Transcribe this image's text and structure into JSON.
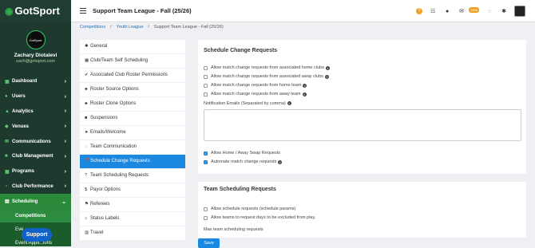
{
  "brand": {
    "logo_text": "GotSport",
    "accent": "#2db34a"
  },
  "user": {
    "name": "Zachary Diotalevi",
    "email": "zach@gotsport.com",
    "avatar_text": "GotSport"
  },
  "sidebar": {
    "items": [
      {
        "label": "Dashboard",
        "icon": "dashboard-icon"
      },
      {
        "label": "Users",
        "icon": "users-icon"
      },
      {
        "label": "Analytics",
        "icon": "analytics-icon"
      },
      {
        "label": "Venues",
        "icon": "venues-icon"
      },
      {
        "label": "Communications",
        "icon": "communications-icon"
      },
      {
        "label": "Club Management",
        "icon": "club-icon"
      },
      {
        "label": "Programs",
        "icon": "programs-icon"
      },
      {
        "label": "Club Performance",
        "icon": "performance-icon"
      },
      {
        "label": "Scheduling",
        "icon": "scheduling-icon"
      }
    ],
    "sub_items": [
      {
        "label": "Competitions"
      },
      {
        "label": "Eve"
      },
      {
        "label": "Event Appli...ions"
      }
    ],
    "support_label": "Support"
  },
  "header": {
    "title": "Support Team League - Fall (25/26)",
    "mail_badge": "1569"
  },
  "breadcrumb": [
    "Competitions",
    "Youth League",
    "Support Team League - Fall (25/26)"
  ],
  "menu": {
    "items": [
      {
        "label": "General",
        "icon": "gear-icon"
      },
      {
        "label": "Club/Team Self Scheduling",
        "icon": "calendar-icon"
      },
      {
        "label": "Associated Club Roster Permissions",
        "icon": "check-circle-icon"
      },
      {
        "label": "Roster Source Options",
        "icon": "sitemap-icon"
      },
      {
        "label": "Roster Clone Options",
        "icon": "sitemap-icon"
      },
      {
        "label": "Suspensions",
        "icon": "square-icon"
      },
      {
        "label": "Emails/Welcome",
        "icon": "send-icon"
      },
      {
        "label": "Team Communication",
        "icon": "chat-icon"
      },
      {
        "label": "Schedule Change Requests",
        "icon": "question-circle-icon"
      },
      {
        "label": "Team Scheduling Requests",
        "icon": "question-circle-icon"
      },
      {
        "label": "Payor Options",
        "icon": "dollar-icon"
      },
      {
        "label": "Referees",
        "icon": "flag-icon"
      },
      {
        "label": "Status Labels",
        "icon": "tags-icon"
      },
      {
        "label": "Travel",
        "icon": "book-icon"
      }
    ],
    "selected": "Schedule Change Requests"
  },
  "schedule_change": {
    "title": "Schedule Change Requests",
    "options": [
      {
        "label": "Allow match change requests from associated home clubs",
        "checked": false
      },
      {
        "label": "Allow match change requests from associated away clubs",
        "checked": false
      },
      {
        "label": "Allow match change requests from home team",
        "checked": false
      },
      {
        "label": "Allow match change requests from away team",
        "checked": false
      }
    ],
    "notification_label": "Notification Emails (Separated by comma)",
    "notification_value": "",
    "swap_label": "Allow Home / Away Swap Requests",
    "automate_label": "Automate match change requests"
  },
  "team_scheduling": {
    "title": "Team Scheduling Requests",
    "options": [
      {
        "label": "Allow schedule requests (schedule params)",
        "checked": false
      },
      {
        "label": "Allow teams to request days to be excluded from play.",
        "checked": false
      }
    ],
    "max_label": "Max team scheduling requests"
  },
  "save_label": "Save"
}
